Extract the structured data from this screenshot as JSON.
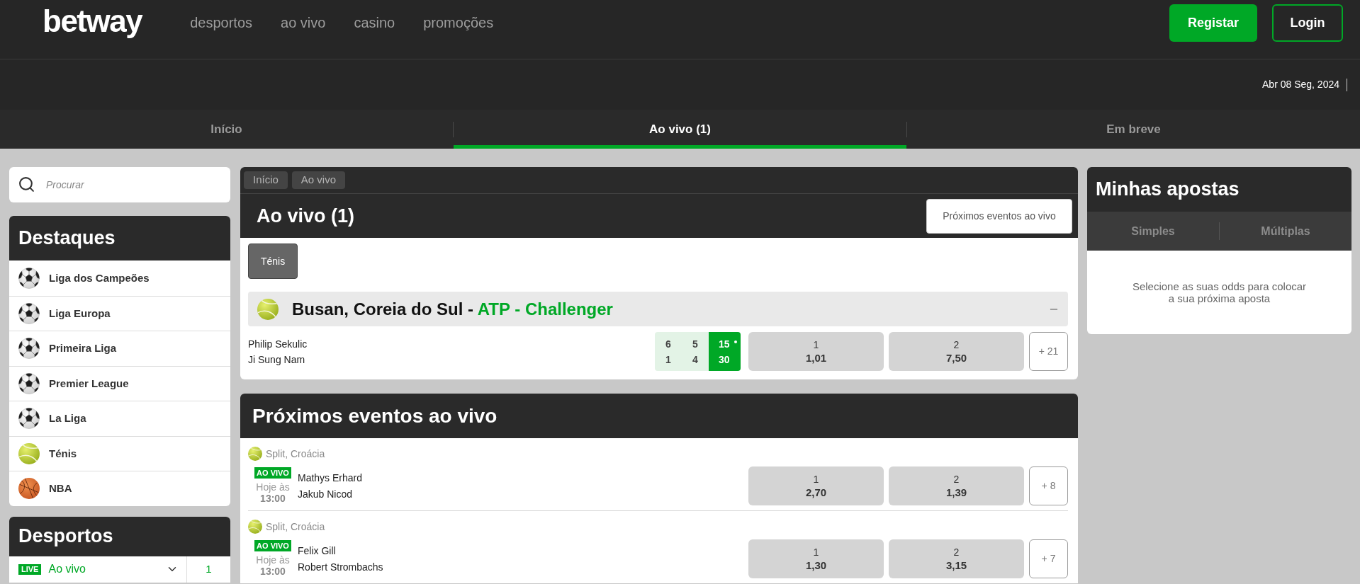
{
  "header": {
    "logo": "betway",
    "nav": [
      "desportos",
      "ao vivo",
      "casino",
      "promoções"
    ],
    "buttons": [
      {
        "label": "Registar",
        "kind": "primary"
      },
      {
        "label": "Login",
        "kind": "outline"
      }
    ]
  },
  "date_bar": {
    "date": "Abr 08 Seg, 2024"
  },
  "tabs": [
    {
      "label": "Início",
      "selected": false
    },
    {
      "label": "Ao vivo (1)",
      "selected": true
    },
    {
      "label": "Em breve",
      "selected": false
    }
  ],
  "sidebar": {
    "search": {
      "placeholder": "Procurar"
    },
    "highlights": {
      "title": "Destaques",
      "items": [
        {
          "label": "Liga dos Campeões",
          "kind": "football"
        },
        {
          "label": "Liga Europa",
          "kind": "football"
        },
        {
          "label": "Primeira Liga",
          "kind": "football"
        },
        {
          "label": "Premier League",
          "kind": "football"
        },
        {
          "label": "La Liga",
          "kind": "football"
        },
        {
          "label": "Ténis",
          "kind": "tennis"
        },
        {
          "label": "NBA",
          "kind": "basketball"
        }
      ]
    },
    "sports": {
      "title": "Desportos",
      "items": [
        {
          "badge": "LIVE",
          "label": "Ao vivo",
          "count": "1"
        }
      ]
    }
  },
  "live": {
    "breadcrumbs": [
      "Início",
      "Ao vivo"
    ],
    "title": "Ao vivo (1)",
    "button": "Próximos eventos ao vivo",
    "filters": [
      {
        "label": "Ténis",
        "selected": true
      }
    ],
    "competitions": [
      {
        "location": "Busan, Coreia do Sul -",
        "name": "ATP - Challenger",
        "expanded": true,
        "matches": [
          {
            "players": [
              {
                "name": "Philip Sekulic",
                "sets": [
                  "6",
                  "5"
                ],
                "game": "15",
                "serving": true
              },
              {
                "name": "Ji Sung Nam",
                "sets": [
                  "1",
                  "4"
                ],
                "game": "30",
                "serving": false
              }
            ],
            "odds": [
              {
                "label": "1",
                "value": "1,01"
              },
              {
                "label": "2",
                "value": "7,50"
              }
            ],
            "more": "+ 21"
          }
        ]
      }
    ]
  },
  "upcoming": {
    "title": "Próximos eventos ao vivo",
    "events": [
      {
        "location": "Split, Croácia",
        "badge": "AO VIVO",
        "day": "Hoje às",
        "time": "13:00",
        "players": [
          "Mathys Erhard",
          "Jakub Nicod"
        ],
        "odds": [
          {
            "label": "1",
            "value": "2,70"
          },
          {
            "label": "2",
            "value": "1,39"
          }
        ],
        "more": "+ 8"
      },
      {
        "location": "Split, Croácia",
        "badge": "AO VIVO",
        "day": "Hoje às",
        "time": "13:00",
        "players": [
          "Felix Gill",
          "Robert Strombachs"
        ],
        "odds": [
          {
            "label": "1",
            "value": "1,30"
          },
          {
            "label": "2",
            "value": "3,15"
          }
        ],
        "more": "+ 7"
      }
    ]
  },
  "bet_slip": {
    "title": "Minhas apostas",
    "tabs": [
      {
        "label": "Simples",
        "disabled": true
      },
      {
        "label": "Múltiplas",
        "disabled": true
      }
    ],
    "message": "Selecione as suas odds para colocar a sua próxima aposta"
  }
}
